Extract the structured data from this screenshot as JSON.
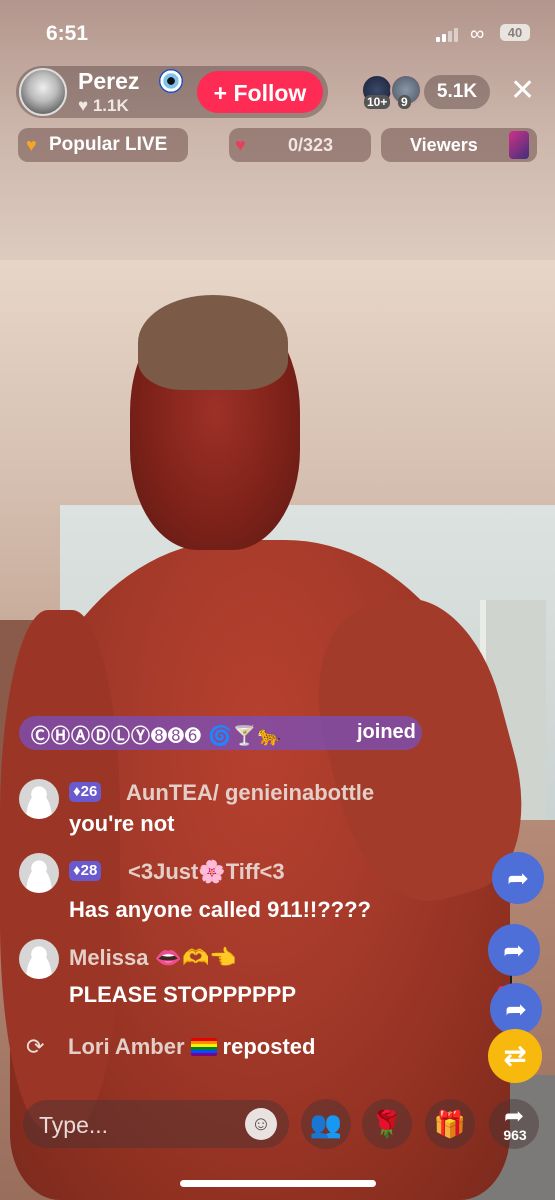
{
  "status_bar": {
    "time": "6:51",
    "battery": "40"
  },
  "header": {
    "host_name": "Perez",
    "likes": "♥ 1.1K",
    "follow_label": "+ Follow",
    "viewer_badges": [
      "10+",
      "9"
    ],
    "viewer_count": "5.1K",
    "close_icon": "close-icon"
  },
  "pills": {
    "popular_label": "Popular LIVE",
    "gift_goal": "0/323",
    "viewers_label": "Viewers"
  },
  "chat": {
    "joined": {
      "name": "ⒸⒽⒶⒹⓁⓎ➑➑➏ 🌀🍸🐆",
      "text": "joined"
    },
    "messages": [
      {
        "level": "26",
        "user": "AunTEA/ genieinabottle",
        "text": "you're not"
      },
      {
        "level": "28",
        "user": "<3Just🌸Tiff<3",
        "text": "Has anyone called 911!!????"
      },
      {
        "level": "",
        "user": "Melissa 👄🫶👈",
        "text": "PLEASE STOPPPPPP"
      }
    ],
    "repost": {
      "user": "Lori Amber",
      "text": "reposted"
    }
  },
  "bottom_bar": {
    "comment_placeholder": "Type...",
    "share_count": "963"
  },
  "colors": {
    "follow": "#fe2c55",
    "share_fab": "#4f6fd8",
    "repost_fab": "#f8b90f",
    "joined_pill": "#7850be"
  }
}
